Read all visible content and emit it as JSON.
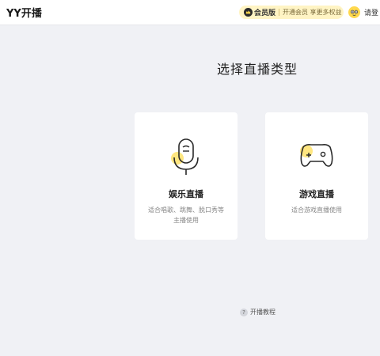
{
  "app": {
    "title": "YY开播"
  },
  "vip": {
    "label": "会员版",
    "desc": "开通会员 享更多权益"
  },
  "user": {
    "login_label": "请登"
  },
  "main": {
    "title": "选择直播类型",
    "cards": [
      {
        "title": "娱乐直播",
        "desc": "适合唱歌、跳舞、脱口秀等主播使用",
        "icon": "microphone-icon"
      },
      {
        "title": "游戏直播",
        "desc": "适合游戏直播使用",
        "icon": "gamepad-icon"
      }
    ]
  },
  "footer": {
    "tutorial_label": "开播教程",
    "tutorial_icon": "?"
  },
  "colors": {
    "accent": "#ffd84d",
    "vip_bg": "#fff4c4",
    "page_bg": "#f0f1f5"
  }
}
